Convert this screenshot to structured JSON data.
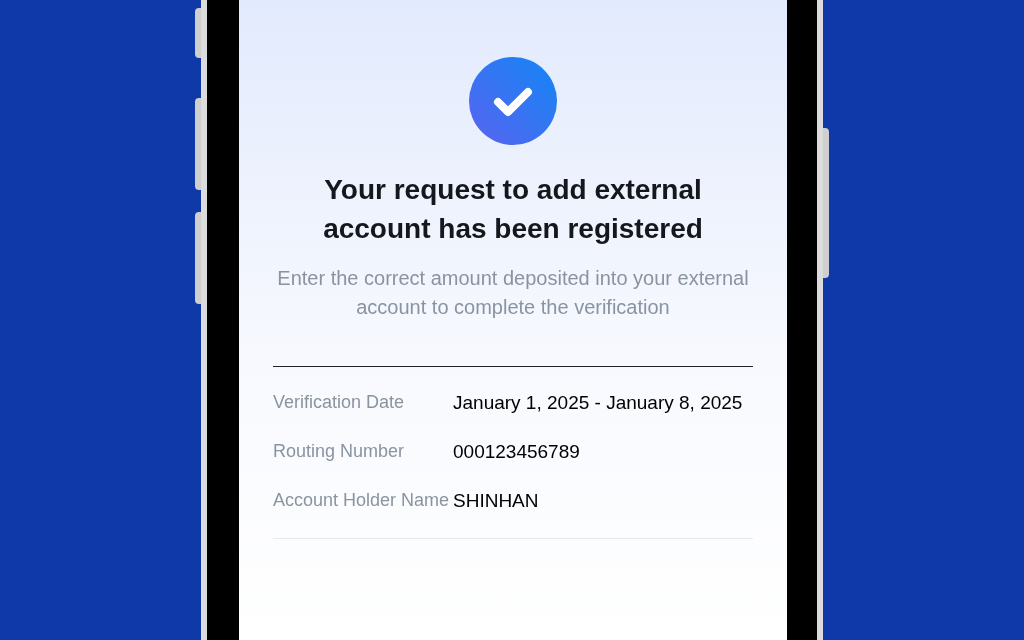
{
  "confirmation": {
    "title": "Your request to add external account has been registered",
    "message": "Enter the correct amount deposited into your external account to complete the verification"
  },
  "details": [
    {
      "label": "Verification Date",
      "value": "January 1, 2025 - January 8, 2025"
    },
    {
      "label": "Routing Number",
      "value": "000123456789"
    },
    {
      "label": "Account Holder Name",
      "value": "SHINHAN"
    }
  ]
}
